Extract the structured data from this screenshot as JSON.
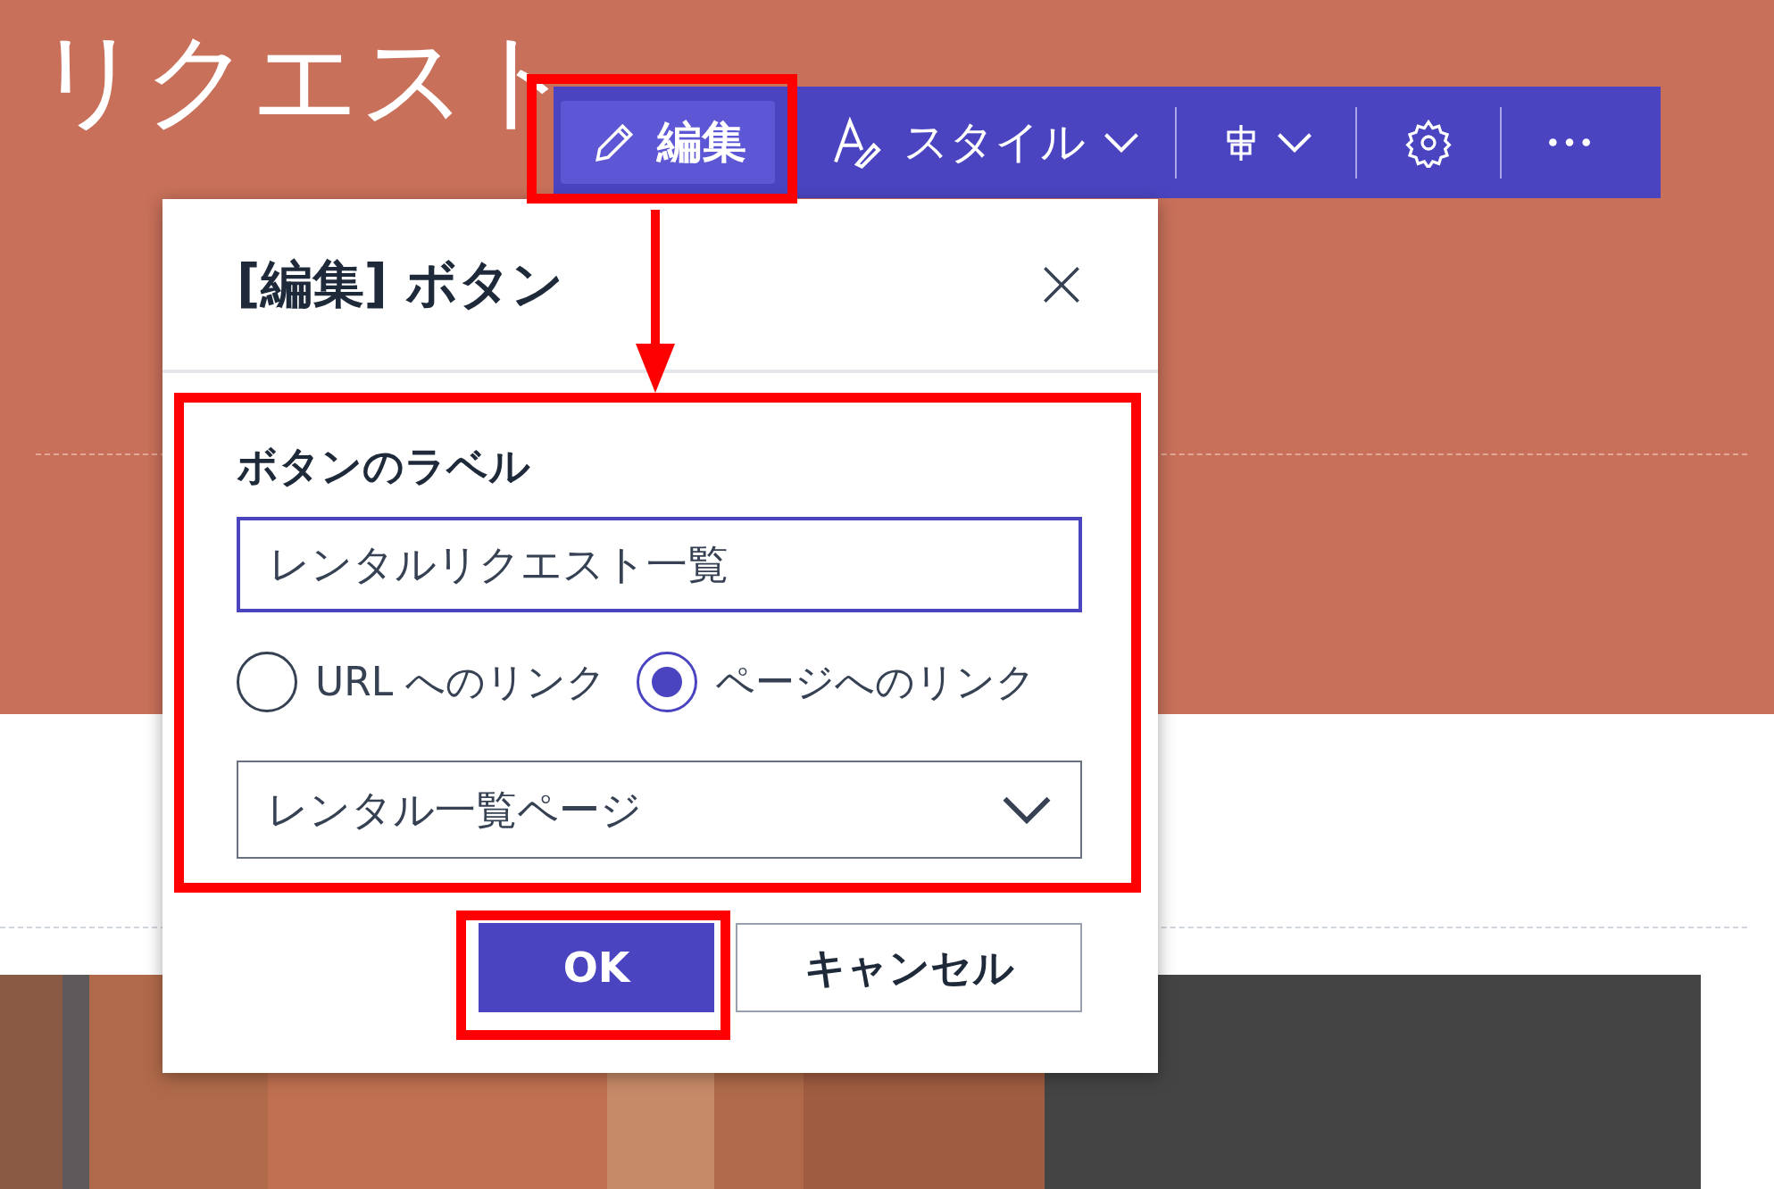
{
  "heading": "リクエスト",
  "toolbar": {
    "items": [
      {
        "kind": "edit",
        "label": "編集",
        "selected": true
      },
      {
        "kind": "style",
        "label": "スタイル",
        "selected": false
      },
      {
        "kind": "align",
        "selected": false
      },
      {
        "kind": "settings",
        "selected": false
      },
      {
        "kind": "more",
        "selected": false
      }
    ]
  },
  "dialog": {
    "title": "[編集] ボタン",
    "field_label": "ボタンのラベル",
    "input_value": "レンタルリクエスト一覧",
    "radios": [
      {
        "label": "URL へのリンク",
        "selected": false
      },
      {
        "label": "ページへのリンク",
        "selected": true
      }
    ],
    "dropdown_value": "レンタル一覧ページ",
    "buttons": [
      {
        "kind": "primary",
        "label": "OK"
      },
      {
        "kind": "secondary",
        "label": "キャンセル"
      }
    ]
  }
}
